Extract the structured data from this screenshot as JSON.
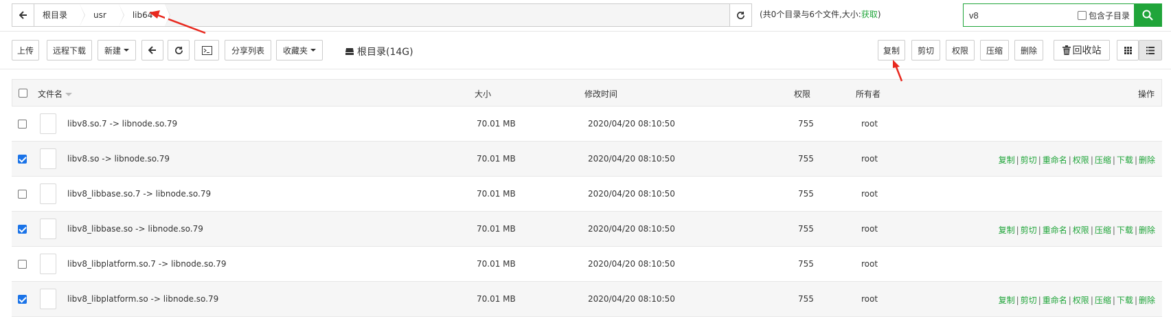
{
  "path": {
    "crumbs": [
      "根目录",
      "usr",
      "lib64"
    ],
    "summary": "(共0个目录与6个文件,大小:",
    "summary_link": "获取",
    "summary_end": ")"
  },
  "search": {
    "value": "v8",
    "include_sub_label": "包含子目录"
  },
  "toolbar": {
    "upload": "上传",
    "remote_download": "远程下载",
    "new": "新建",
    "share_list": "分享列表",
    "favorites": "收藏夹",
    "disk": "根目录(14G)",
    "copy": "复制",
    "cut": "剪切",
    "permission": "权限",
    "compress": "压缩",
    "delete": "删除",
    "recycle": "回收站"
  },
  "table": {
    "headers": {
      "name": "文件名",
      "size": "大小",
      "mtime": "修改时间",
      "perm": "权限",
      "owner": "所有者",
      "actions": "操作"
    },
    "action_labels": [
      "复制",
      "剪切",
      "重命名",
      "权限",
      "压缩",
      "下载",
      "删除"
    ],
    "rows": [
      {
        "name": "libv8.so.7 -> libnode.so.79",
        "size": "70.01 MB",
        "mtime": "2020/04/20 08:10:50",
        "perm": "755",
        "owner": "root",
        "checked": false
      },
      {
        "name": "libv8.so -> libnode.so.79",
        "size": "70.01 MB",
        "mtime": "2020/04/20 08:10:50",
        "perm": "755",
        "owner": "root",
        "checked": true
      },
      {
        "name": "libv8_libbase.so.7 -> libnode.so.79",
        "size": "70.01 MB",
        "mtime": "2020/04/20 08:10:50",
        "perm": "755",
        "owner": "root",
        "checked": false
      },
      {
        "name": "libv8_libbase.so -> libnode.so.79",
        "size": "70.01 MB",
        "mtime": "2020/04/20 08:10:50",
        "perm": "755",
        "owner": "root",
        "checked": true
      },
      {
        "name": "libv8_libplatform.so.7 -> libnode.so.79",
        "size": "70.01 MB",
        "mtime": "2020/04/20 08:10:50",
        "perm": "755",
        "owner": "root",
        "checked": false
      },
      {
        "name": "libv8_libplatform.so -> libnode.so.79",
        "size": "70.01 MB",
        "mtime": "2020/04/20 08:10:50",
        "perm": "755",
        "owner": "root",
        "checked": true
      }
    ]
  },
  "colors": {
    "accent": "#20a53a",
    "annotation": "#e8281e"
  }
}
